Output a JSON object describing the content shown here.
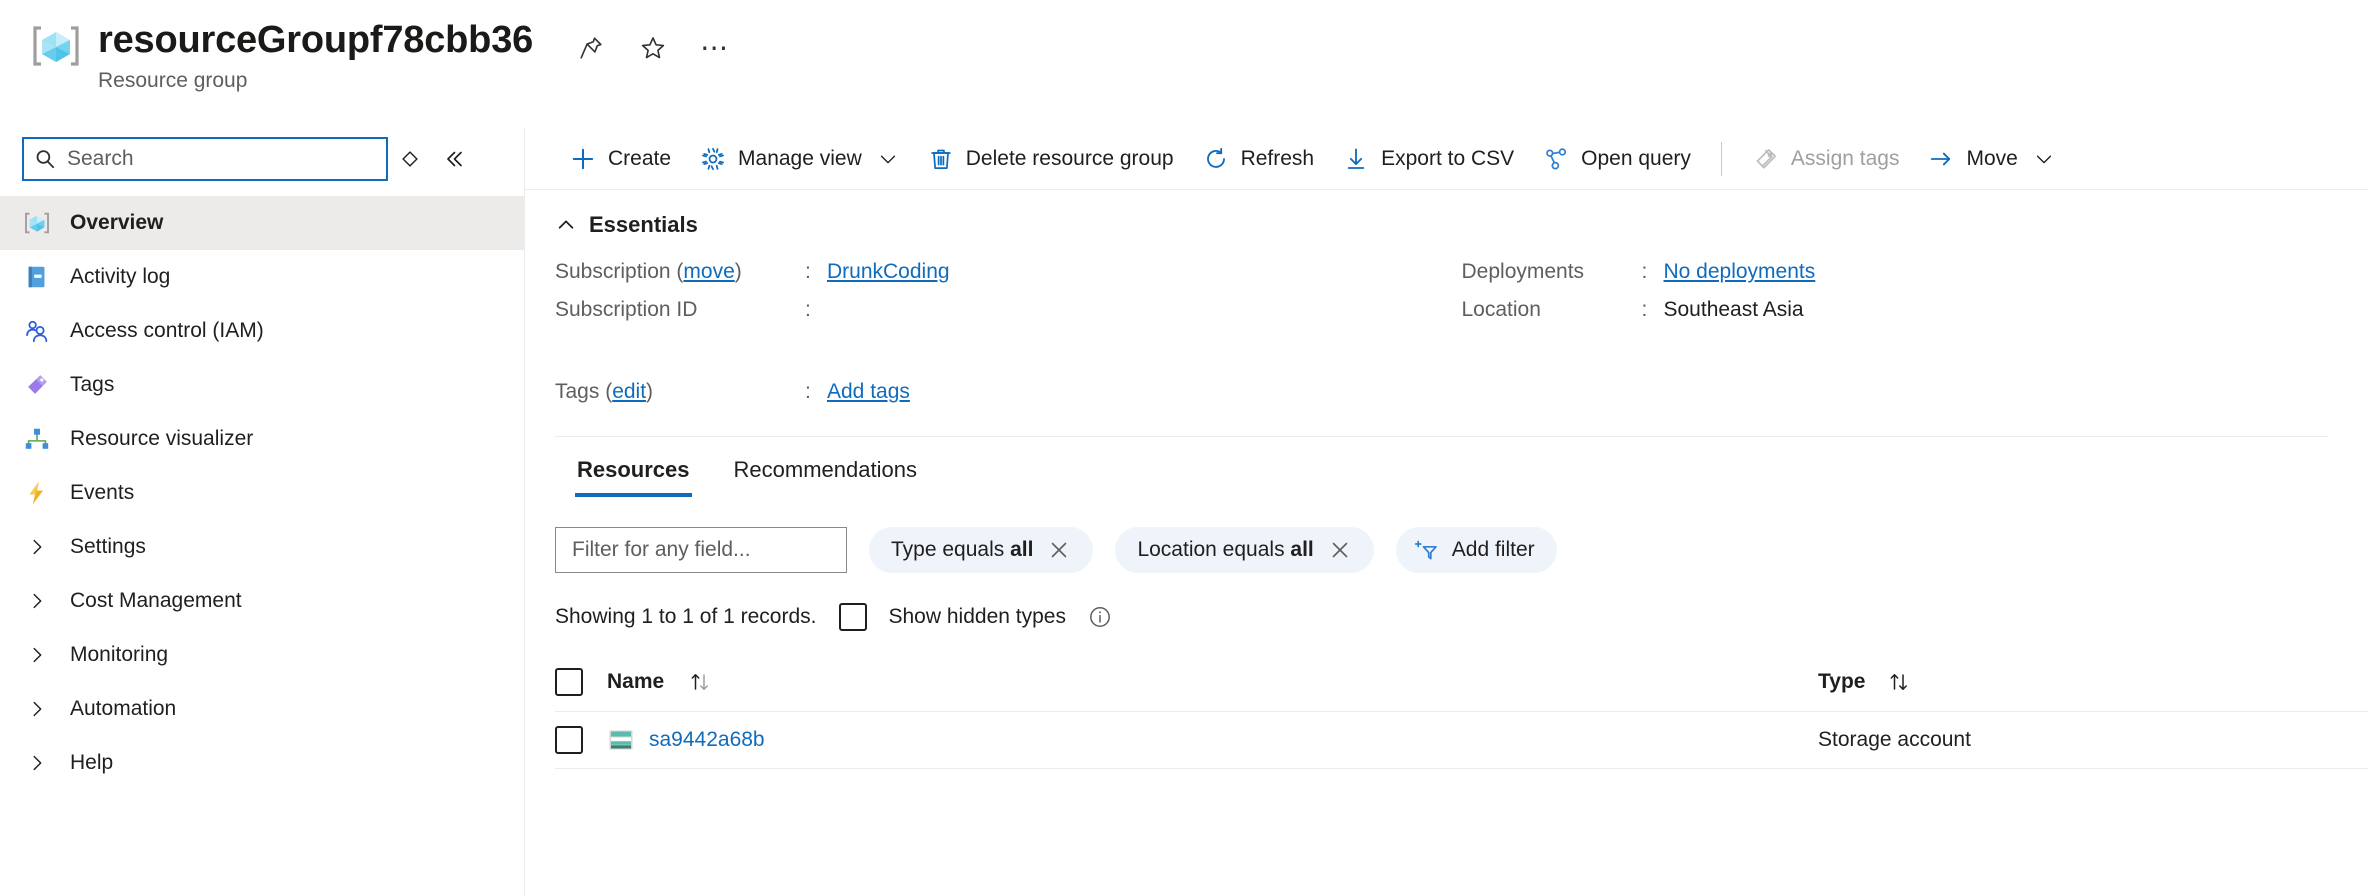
{
  "header": {
    "title": "resourceGroupf78cbb36",
    "subtitle": "Resource group",
    "icon": "resource-group-icon",
    "actions": [
      {
        "name": "pin-icon",
        "label": "Pin blade"
      },
      {
        "name": "favorite-star-icon",
        "label": "Add to favorites"
      },
      {
        "name": "more-ellipsis-icon",
        "label": "More"
      }
    ]
  },
  "sidebar": {
    "search": {
      "placeholder": "Search",
      "value": "",
      "icon": "search-icon"
    },
    "tools": [
      {
        "name": "expand-collapse-icon",
        "glyph": "◇"
      },
      {
        "name": "collapse-panel-icon",
        "glyph": "«"
      }
    ],
    "items": [
      {
        "label": "Overview",
        "icon": "resource-group-icon",
        "selected": true,
        "group": false
      },
      {
        "label": "Activity log",
        "icon": "activity-log-icon",
        "selected": false,
        "group": false
      },
      {
        "label": "Access control (IAM)",
        "icon": "access-control-icon",
        "selected": false,
        "group": false
      },
      {
        "label": "Tags",
        "icon": "tags-icon",
        "selected": false,
        "group": false
      },
      {
        "label": "Resource visualizer",
        "icon": "resource-visualizer-icon",
        "selected": false,
        "group": false
      },
      {
        "label": "Events",
        "icon": "events-lightning-icon",
        "selected": false,
        "group": false
      },
      {
        "label": "Settings",
        "icon": "chevron-right-icon",
        "selected": false,
        "group": true
      },
      {
        "label": "Cost Management",
        "icon": "chevron-right-icon",
        "selected": false,
        "group": true
      },
      {
        "label": "Monitoring",
        "icon": "chevron-right-icon",
        "selected": false,
        "group": true
      },
      {
        "label": "Automation",
        "icon": "chevron-right-icon",
        "selected": false,
        "group": true
      },
      {
        "label": "Help",
        "icon": "chevron-right-icon",
        "selected": false,
        "group": true
      }
    ]
  },
  "toolbar": {
    "commands": [
      {
        "label": "Create",
        "icon": "plus-icon",
        "caret": false,
        "disabled": false
      },
      {
        "label": "Manage view",
        "icon": "gear-icon",
        "caret": true,
        "disabled": false
      },
      {
        "label": "Delete resource group",
        "icon": "trash-icon",
        "caret": false,
        "disabled": false
      },
      {
        "label": "Refresh",
        "icon": "refresh-icon",
        "caret": false,
        "disabled": false
      },
      {
        "label": "Export to CSV",
        "icon": "download-arrow-icon",
        "caret": false,
        "disabled": false
      },
      {
        "label": "Open query",
        "icon": "open-query-icon",
        "caret": false,
        "disabled": false
      },
      {
        "label": "Assign tags",
        "icon": "assign-tags-icon",
        "caret": false,
        "disabled": true
      },
      {
        "label": "Move",
        "icon": "move-arrow-icon",
        "caret": true,
        "disabled": false
      }
    ]
  },
  "essentials": {
    "heading": "Essentials",
    "left": [
      {
        "key": "Subscription",
        "key_link": "move",
        "key_suffix": ")",
        "key_prefix": " (",
        "colon": ":",
        "value": "DrunkCoding",
        "value_is_link": true
      },
      {
        "key": "Subscription ID",
        "colon": ":",
        "value": "",
        "value_is_link": false
      },
      {
        "key": "Tags",
        "key_link": "edit",
        "key_prefix": " (",
        "key_suffix": ")",
        "colon": ":",
        "value": "Add tags",
        "value_is_link": true
      }
    ],
    "right": [
      {
        "key": "Deployments",
        "colon": ":",
        "value": "No deployments",
        "value_is_link": true
      },
      {
        "key": "Location",
        "colon": ":",
        "value": "Southeast Asia",
        "value_is_link": false
      }
    ]
  },
  "tabs": [
    {
      "label": "Resources",
      "active": true
    },
    {
      "label": "Recommendations",
      "active": false
    }
  ],
  "filters": {
    "field_placeholder": "Filter for any field...",
    "field_value": "",
    "pills": [
      {
        "text": "Type equals ",
        "bold": "all",
        "close_icon": "close-x-icon"
      },
      {
        "text": "Location equals ",
        "bold": "all",
        "close_icon": "close-x-icon"
      }
    ],
    "add_filter": {
      "label": "Add filter",
      "icon": "add-filter-icon"
    }
  },
  "records": {
    "showing_text": "Showing 1 to 1 of 1 records.",
    "show_hidden_label": "Show hidden types",
    "show_hidden_checked": false,
    "info_icon": "info-circle-icon"
  },
  "table": {
    "columns": [
      {
        "label": "Name",
        "sort_icon": "sort-updown-icon"
      },
      {
        "label": "Type",
        "sort_icon": "sort-updown-icon"
      }
    ],
    "rows": [
      {
        "checked": false,
        "icon": "storage-account-icon",
        "name": "sa9442a68b",
        "type": "Storage account"
      }
    ]
  },
  "colors": {
    "accent": "#0f6cbd",
    "link": "#0f6cbd",
    "selected_nav_bg": "#edebe9",
    "pill_bg": "#eff4fb",
    "disabled_text": "#a19f9d",
    "border": "#edebe9",
    "storage_teal": "#5bbcad"
  }
}
